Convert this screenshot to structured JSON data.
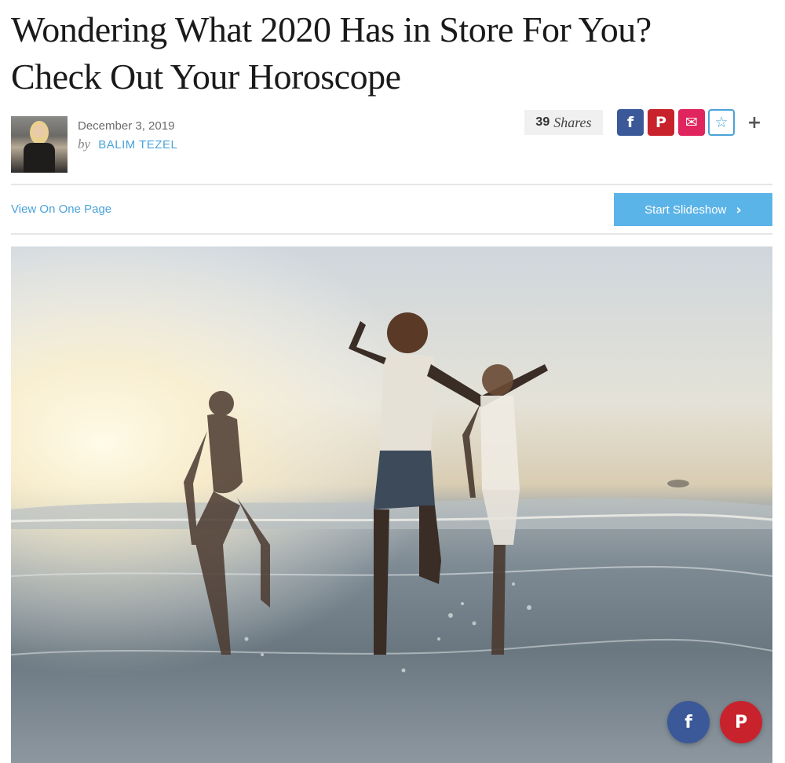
{
  "article": {
    "title": "Wondering What 2020 Has in Store For You? Check Out Your Horoscope",
    "date": "December 3, 2019",
    "by_label": "by",
    "author": "BALIM TEZEL"
  },
  "shares": {
    "count": "39",
    "label": "Shares"
  },
  "share_buttons": [
    {
      "name": "facebook",
      "glyph": "f",
      "color": "#3b5998"
    },
    {
      "name": "pinterest",
      "glyph": "P",
      "color": "#c8232c"
    },
    {
      "name": "email",
      "glyph": "✉",
      "color": "#e0245e"
    },
    {
      "name": "favorite",
      "glyph": "☆",
      "color": "#4aa3d9"
    }
  ],
  "more_glyph": "+",
  "nav": {
    "view_one_page": "View On One Page",
    "start_slideshow": "Start Slideshow",
    "slideshow_chevron": "›"
  },
  "floating_share": [
    {
      "name": "facebook",
      "glyph": "f",
      "color": "#3b5998"
    },
    {
      "name": "pinterest",
      "glyph": "P",
      "color": "#c8232c"
    }
  ],
  "colors": {
    "accent": "#4aa3d9",
    "slideshow_button": "#5bb4e8"
  }
}
